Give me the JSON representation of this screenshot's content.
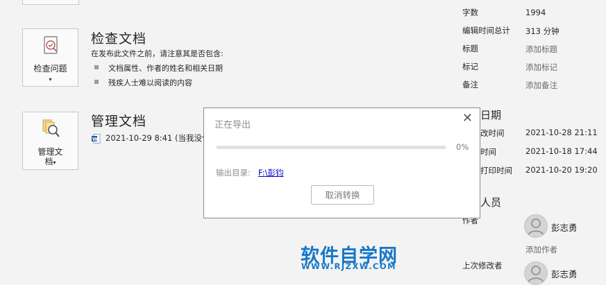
{
  "inspect": {
    "tile_label": "检查问题",
    "title": "检查文档",
    "intro": "在发布此文件之前，请注意其是否包含:",
    "items": [
      "文档属性、作者的姓名和相关日期",
      "残疾人士难以阅读的内容"
    ]
  },
  "manage": {
    "tile_label_line1": "管理文",
    "tile_label_line2": "档",
    "title": "管理文档",
    "version_text": "2021-10-29 8:41 (当我没保"
  },
  "properties": {
    "word_count_label": "字数",
    "word_count_value": "1994",
    "edit_time_label": "编辑时间总计",
    "edit_time_value": "313 分钟",
    "title_label": "标题",
    "title_link": "添加标题",
    "tags_label": "标记",
    "tags_link": "添加标记",
    "comments_label": "备注",
    "comments_link": "添加备注"
  },
  "dates": {
    "header": "日期",
    "modified_label": "改时间",
    "modified_value": "2021-10-28 21:11",
    "created_label": "时间",
    "created_value": "2021-10-18 17:44",
    "printed_label": "打印时间",
    "printed_value": "2021-10-20 19:20"
  },
  "people": {
    "header": "人员",
    "author_label": "作者",
    "author_name": "彭志勇",
    "add_author": "添加作者",
    "last_modified_label": "上次修改者",
    "last_modified_name": "彭志勇"
  },
  "dialog": {
    "title": "正在导出",
    "close": "✕",
    "progress": 0,
    "percent_text": "0%",
    "output_label": "输出目录:",
    "output_path": "F:\\彭钧",
    "cancel_label": "取消转换"
  },
  "watermark": {
    "cn": "软件自学网",
    "en": "WWW.RJZXW.COM"
  }
}
